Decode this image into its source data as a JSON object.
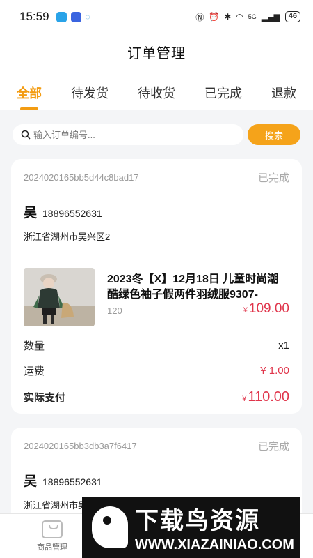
{
  "status_bar": {
    "time": "15:59",
    "network": "5G",
    "battery": "46"
  },
  "header": {
    "title": "订单管理"
  },
  "tabs": [
    {
      "label": "全部",
      "active": true
    },
    {
      "label": "待发货",
      "active": false
    },
    {
      "label": "待收货",
      "active": false
    },
    {
      "label": "已完成",
      "active": false
    },
    {
      "label": "退款",
      "active": false
    }
  ],
  "search": {
    "placeholder": "输入订单编号...",
    "button_label": "搜索"
  },
  "orders": [
    {
      "order_no": "2024020165bb5d44c8bad17",
      "status": "已完成",
      "buyer_name": "吴",
      "buyer_phone": "18896552631",
      "address": "浙江省湖州市吴兴区2",
      "product": {
        "title": "2023冬【X】12月18日 儿童时尚潮酷绿色袖子假两件羽绒服9307-",
        "spec": "120",
        "price_symbol": "¥",
        "price": "109.00"
      },
      "quantity_label": "数量",
      "quantity_value": "x1",
      "shipping_label": "运费",
      "shipping_value": "¥ 1.00",
      "paid_label": "实际支付",
      "paid_symbol": "¥",
      "paid_value": "110.00"
    },
    {
      "order_no": "2024020165bb3db3a7f6417",
      "status": "已完成",
      "buyer_name": "吴",
      "buyer_phone": "18896552631",
      "address": "浙江省湖州市吴兴区2"
    }
  ],
  "bottom_nav": {
    "items": [
      {
        "label": "商品管理"
      }
    ]
  },
  "watermark": {
    "title": "下载鸟资源",
    "url": "WWW.XIAZAINIAO.COM"
  },
  "colors": {
    "accent": "#f39c12",
    "price_red": "#e0354b"
  }
}
